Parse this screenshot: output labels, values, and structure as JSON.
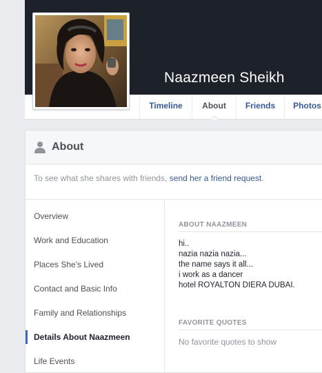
{
  "profile": {
    "name": "Naazmeen Sheikh"
  },
  "tabs": [
    {
      "label": "Timeline"
    },
    {
      "label": "About"
    },
    {
      "label": "Friends"
    },
    {
      "label": "Photos"
    }
  ],
  "about": {
    "title": "About",
    "notice_text": "To see what she shares with friends, ",
    "notice_link": "send her a friend request",
    "notice_end": "."
  },
  "nav": [
    {
      "label": "Overview"
    },
    {
      "label": "Work and Education"
    },
    {
      "label": "Places She's Lived"
    },
    {
      "label": "Contact and Basic Info"
    },
    {
      "label": "Family and Relationships"
    },
    {
      "label": "Details About Naazmeen"
    },
    {
      "label": "Life Events"
    }
  ],
  "details": {
    "about_title": "ABOUT NAAZMEEN",
    "bio": [
      "hi..",
      "nazia nazia nazia...",
      "the name says it all...",
      "i work as a dancer",
      "hotel ROYALTON DIERA DUBAI."
    ],
    "quotes_title": "FAVORITE QUOTES",
    "quotes_empty": "No favorite quotes to show"
  },
  "colors": {
    "link": "#365899",
    "cover": "#1d2129",
    "active_indicator": "#4267b2"
  }
}
